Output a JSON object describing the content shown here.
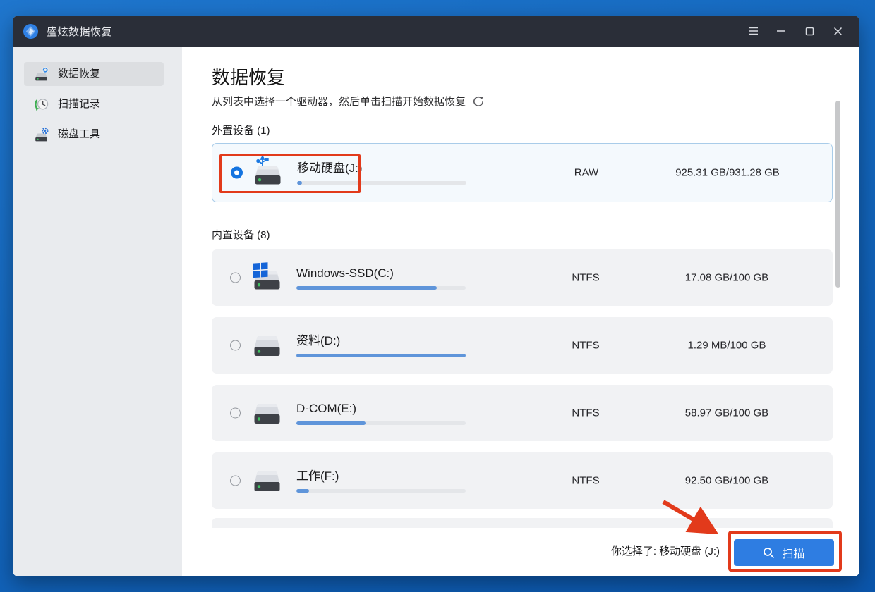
{
  "titlebar": {
    "app_name": "盛炫数据恢复",
    "controls": [
      "menu",
      "minimize",
      "maximize",
      "close"
    ]
  },
  "sidebar": {
    "items": [
      {
        "label": "数据恢复",
        "icon": "data-recovery-icon",
        "selected": true
      },
      {
        "label": "扫描记录",
        "icon": "scan-history-icon",
        "selected": false
      },
      {
        "label": "磁盘工具",
        "icon": "disk-tools-icon",
        "selected": false
      }
    ]
  },
  "main": {
    "title": "数据恢复",
    "subtitle": "从列表中选择一个驱动器，然后单击扫描开始数据恢复",
    "refresh_icon": "refresh-icon",
    "sections": [
      {
        "label": "外置设备 (1)",
        "devices": [
          {
            "name": "移动硬盘(J:)",
            "fs": "RAW",
            "capacity": "925.31 GB/931.28 GB",
            "used_percent": 3,
            "selected": true,
            "icon": "usb-drive-icon"
          }
        ]
      },
      {
        "label": "内置设备 (8)",
        "devices": [
          {
            "name": "Windows-SSD(C:)",
            "fs": "NTFS",
            "capacity": "17.08 GB/100 GB",
            "used_percent": 83,
            "selected": false,
            "icon": "windows-drive-icon"
          },
          {
            "name": "资料(D:)",
            "fs": "NTFS",
            "capacity": "1.29 MB/100 GB",
            "used_percent": 100,
            "selected": false,
            "icon": "hard-drive-icon"
          },
          {
            "name": "D-COM(E:)",
            "fs": "NTFS",
            "capacity": "58.97 GB/100 GB",
            "used_percent": 41,
            "selected": false,
            "icon": "hard-drive-icon"
          },
          {
            "name": "工作(F:)",
            "fs": "NTFS",
            "capacity": "92.50 GB/100 GB",
            "used_percent": 7.5,
            "selected": false,
            "icon": "hard-drive-icon"
          }
        ]
      }
    ]
  },
  "footer": {
    "selection_text": "你选择了: 移动硬盘 (J:)",
    "scan_button": "扫描"
  },
  "colors": {
    "accent_blue": "#2e7de2",
    "radio_blue": "#1474e0",
    "bar_fill_blue": "#5f95da",
    "annotation_red": "#e23a1b",
    "titlebar_bg": "#2a2e38",
    "sidebar_bg": "#e9ebee",
    "row_bg": "#f1f2f4",
    "selected_row_bg": "#f4f9fd",
    "selected_row_border": "#a9cce9",
    "desktop_blue": "#0b56ac"
  }
}
